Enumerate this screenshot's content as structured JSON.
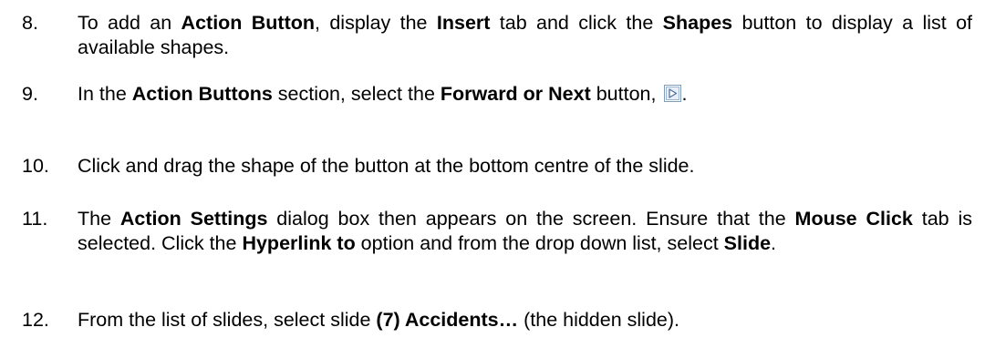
{
  "steps": [
    {
      "number": "8.",
      "segments": [
        {
          "text": "To add an ",
          "bold": false
        },
        {
          "text": "Action Button",
          "bold": true
        },
        {
          "text": ", display the ",
          "bold": false
        },
        {
          "text": "Insert",
          "bold": true
        },
        {
          "text": " tab and click the ",
          "bold": false
        },
        {
          "text": "Shapes",
          "bold": true
        },
        {
          "text": " button to display a list of available shapes.",
          "bold": false
        }
      ]
    },
    {
      "number": "9.",
      "segments": [
        {
          "text": "In the ",
          "bold": false
        },
        {
          "text": "Action Buttons",
          "bold": true
        },
        {
          "text": " section, select the ",
          "bold": false
        },
        {
          "text": "Forward or Next",
          "bold": true
        },
        {
          "text": " button, ",
          "bold": false
        }
      ],
      "inline_icon": "forward-next-action-button-icon",
      "trailing_text": "."
    },
    {
      "number": "10.",
      "segments": [
        {
          "text": "Click and drag the shape of the button at the bottom centre of the slide.",
          "bold": false
        }
      ]
    },
    {
      "number": "11.",
      "segments": [
        {
          "text": "The ",
          "bold": false
        },
        {
          "text": "Action Settings",
          "bold": true
        },
        {
          "text": " dialog box then appears on the screen. Ensure that the ",
          "bold": false
        },
        {
          "text": "Mouse Click",
          "bold": true
        },
        {
          "text": " tab is selected. Click the ",
          "bold": false
        },
        {
          "text": "Hyperlink to",
          "bold": true
        },
        {
          "text": " option and from the drop down list, select ",
          "bold": false
        },
        {
          "text": "Slide",
          "bold": true
        },
        {
          "text": ".",
          "bold": false
        }
      ]
    },
    {
      "number": "12.",
      "segments": [
        {
          "text": "From the list of slides, select slide ",
          "bold": false
        },
        {
          "text": "(7) Accidents…",
          "bold": true
        },
        {
          "text": " (the hidden slide).",
          "bold": false
        }
      ]
    }
  ],
  "colors": {
    "text": "#000000",
    "icon_border": "#7f9db9",
    "icon_fill": "#e8eef7",
    "icon_triangle": "#4a6d9c"
  }
}
